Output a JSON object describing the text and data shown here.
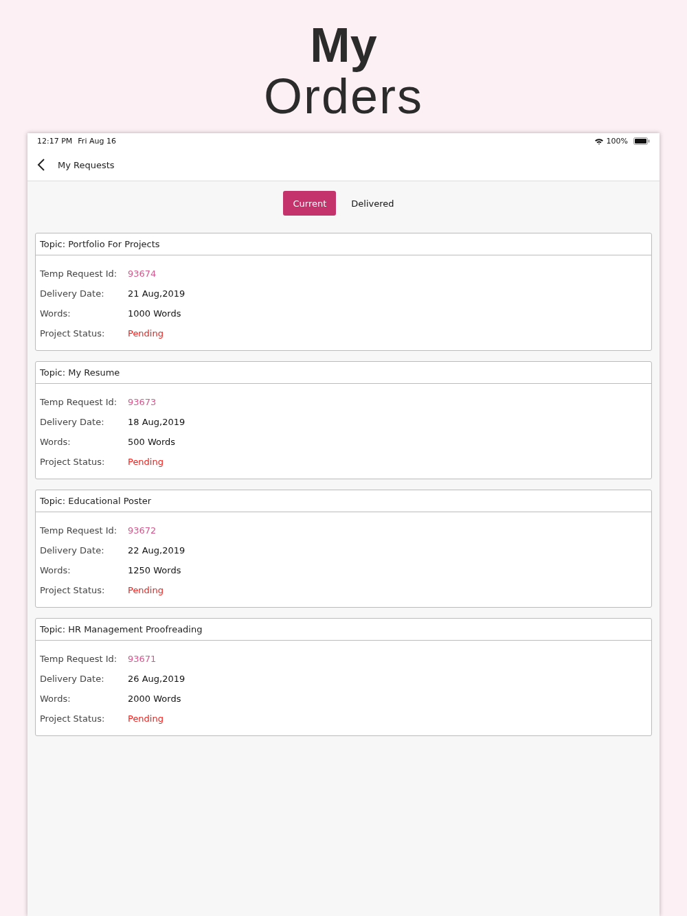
{
  "heading": {
    "line_1": "My",
    "line_2": "Orders"
  },
  "status_bar": {
    "time": "12:17 PM",
    "date": "Fri Aug 16",
    "battery": "100%"
  },
  "nav": {
    "title": "My Requests"
  },
  "tabs": [
    {
      "label": "Current",
      "selected": true
    },
    {
      "label": "Delivered",
      "selected": false
    }
  ],
  "orders": [
    {
      "topic": "Topic: Portfolio For Projects",
      "fields": [
        {
          "label": "Temp Request Id:",
          "value": "93674",
          "kind": "id"
        },
        {
          "label": "Delivery Date:",
          "value": "21 Aug,2019",
          "kind": "plain"
        },
        {
          "label": "Words:",
          "value": "1000 Words",
          "kind": "plain"
        },
        {
          "label": "Project Status:",
          "value": "Pending",
          "kind": "status"
        }
      ]
    },
    {
      "topic": "Topic: My Resume",
      "fields": [
        {
          "label": "Temp Request Id:",
          "value": "93673",
          "kind": "id"
        },
        {
          "label": "Delivery Date:",
          "value": "18 Aug,2019",
          "kind": "plain"
        },
        {
          "label": "Words:",
          "value": "500 Words",
          "kind": "plain"
        },
        {
          "label": "Project Status:",
          "value": "Pending",
          "kind": "status"
        }
      ]
    },
    {
      "topic": "Topic: Educational Poster",
      "fields": [
        {
          "label": "Temp Request Id:",
          "value": "93672",
          "kind": "id"
        },
        {
          "label": "Delivery Date:",
          "value": "22 Aug,2019",
          "kind": "plain"
        },
        {
          "label": "Words:",
          "value": "1250 Words",
          "kind": "plain"
        },
        {
          "label": "Project Status:",
          "value": "Pending",
          "kind": "status"
        }
      ]
    },
    {
      "topic": "Topic: HR Management Proofreading",
      "fields": [
        {
          "label": "Temp Request Id:",
          "value": "93671",
          "kind": "id"
        },
        {
          "label": "Delivery Date:",
          "value": "26 Aug,2019",
          "kind": "plain"
        },
        {
          "label": "Words:",
          "value": "2000 Words",
          "kind": "plain"
        },
        {
          "label": "Project Status:",
          "value": "Pending",
          "kind": "status"
        }
      ]
    }
  ]
}
